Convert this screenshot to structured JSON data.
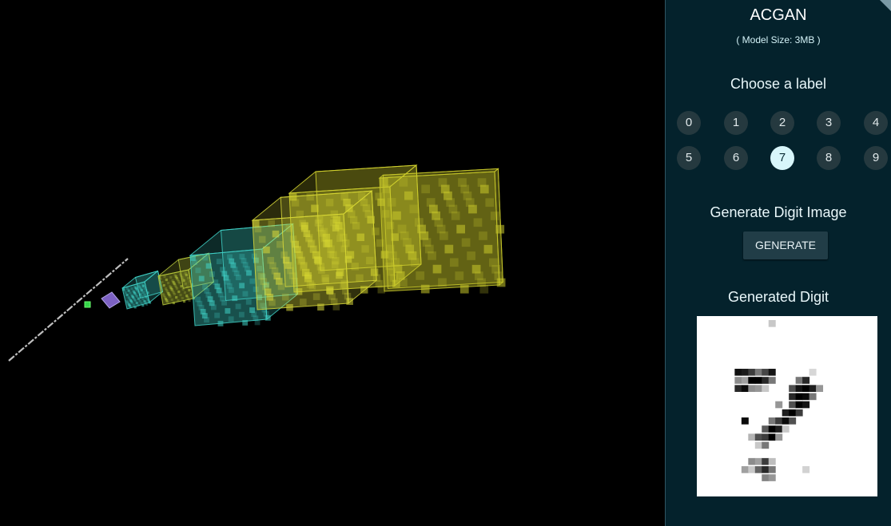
{
  "app": {
    "title": "ACGAN",
    "model_size": "( Model Size: 3MB )"
  },
  "label_picker": {
    "heading": "Choose a label",
    "labels": [
      "0",
      "1",
      "2",
      "3",
      "4",
      "5",
      "6",
      "7",
      "8",
      "9"
    ],
    "selected": "7"
  },
  "generate": {
    "heading": "Generate Digit Image",
    "button_label": "GENERATE"
  },
  "output": {
    "heading": "Generated Digit",
    "dark_pixels": [
      [
        2,
        6,
        15
      ],
      [
        3,
        6,
        25
      ],
      [
        4,
        6,
        60
      ],
      [
        5,
        6,
        120
      ],
      [
        6,
        6,
        70
      ],
      [
        7,
        6,
        20
      ],
      [
        2,
        7,
        140
      ],
      [
        3,
        7,
        160
      ],
      [
        4,
        7,
        0
      ],
      [
        5,
        7,
        0
      ],
      [
        6,
        7,
        40
      ],
      [
        7,
        7,
        120
      ],
      [
        2,
        8,
        40
      ],
      [
        3,
        8,
        10
      ],
      [
        4,
        8,
        140
      ],
      [
        5,
        8,
        150
      ],
      [
        6,
        8,
        200
      ],
      [
        11,
        7,
        120
      ],
      [
        12,
        7,
        40
      ],
      [
        10,
        8,
        80
      ],
      [
        11,
        8,
        20
      ],
      [
        12,
        8,
        0
      ],
      [
        13,
        8,
        30
      ],
      [
        14,
        8,
        150
      ],
      [
        10,
        9,
        40
      ],
      [
        11,
        9,
        0
      ],
      [
        12,
        9,
        10
      ],
      [
        13,
        9,
        120
      ],
      [
        10,
        10,
        80
      ],
      [
        11,
        10,
        0
      ],
      [
        12,
        10,
        20
      ],
      [
        8,
        10,
        150
      ],
      [
        9,
        11,
        30
      ],
      [
        10,
        11,
        0
      ],
      [
        11,
        11,
        60
      ],
      [
        7,
        12,
        120
      ],
      [
        8,
        12,
        60
      ],
      [
        9,
        12,
        10
      ],
      [
        10,
        12,
        80
      ],
      [
        3,
        12,
        10
      ],
      [
        6,
        13,
        90
      ],
      [
        7,
        13,
        0
      ],
      [
        8,
        13,
        30
      ],
      [
        9,
        13,
        200
      ],
      [
        4,
        14,
        180
      ],
      [
        5,
        14,
        80
      ],
      [
        6,
        14,
        60
      ],
      [
        7,
        14,
        0
      ],
      [
        8,
        14,
        150
      ],
      [
        5,
        15,
        200
      ],
      [
        6,
        15,
        120
      ],
      [
        4,
        17,
        140
      ],
      [
        5,
        17,
        160
      ],
      [
        6,
        17,
        60
      ],
      [
        7,
        17,
        190
      ],
      [
        3,
        18,
        160
      ],
      [
        4,
        18,
        200
      ],
      [
        5,
        18,
        100
      ],
      [
        6,
        18,
        40
      ],
      [
        7,
        18,
        120
      ],
      [
        6,
        19,
        130
      ],
      [
        7,
        19,
        150
      ],
      [
        7,
        0,
        200
      ],
      [
        12,
        18,
        210
      ],
      [
        13,
        6,
        215
      ]
    ]
  }
}
